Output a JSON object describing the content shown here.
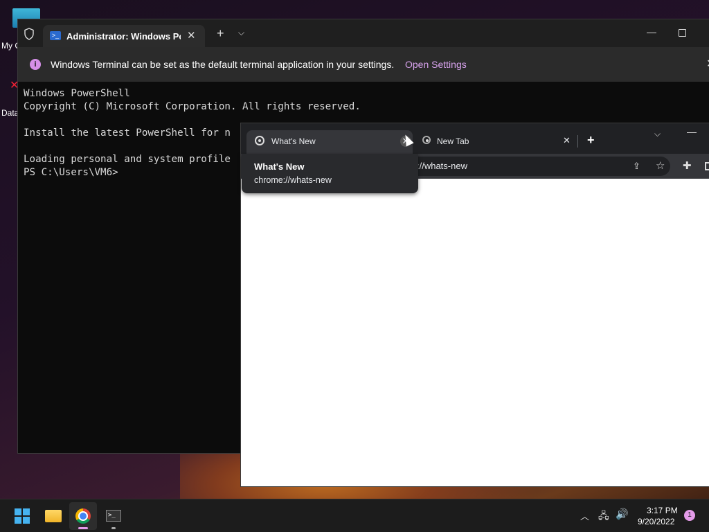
{
  "desktop": {
    "icons": [
      {
        "label": "My C"
      },
      {
        "label": "Data"
      }
    ]
  },
  "terminal": {
    "tab_title": "Administrator: Windows Powe",
    "infobar": {
      "message": "Windows Terminal can be set as the default terminal application in your settings.",
      "link": "Open Settings"
    },
    "lines": [
      "Windows PowerShell",
      "Copyright (C) Microsoft Corporation. All rights reserved.",
      "",
      "Install the latest PowerShell for n",
      "",
      "Loading personal and system profile",
      "PS C:\\Users\\VM6>"
    ]
  },
  "chrome": {
    "tabs": [
      {
        "title": "What's New",
        "active": true
      },
      {
        "title": "New Tab",
        "active": false
      }
    ],
    "omnibox_url": "://whats-new",
    "tooltip": {
      "title": "What's New",
      "url": "chrome://whats-new"
    }
  },
  "taskbar": {
    "apps": [
      {
        "icon": "windows-start-icon"
      },
      {
        "icon": "file-explorer-icon"
      },
      {
        "icon": "chrome-icon"
      },
      {
        "icon": "terminal-icon"
      }
    ],
    "clock": {
      "time": "3:17 PM",
      "date": "9/20/2022"
    },
    "notification_count": "1"
  },
  "colors": {
    "accent": "#e49be9",
    "info_link": "#d8a3ee",
    "terminal_bg": "#0c0c0c"
  }
}
